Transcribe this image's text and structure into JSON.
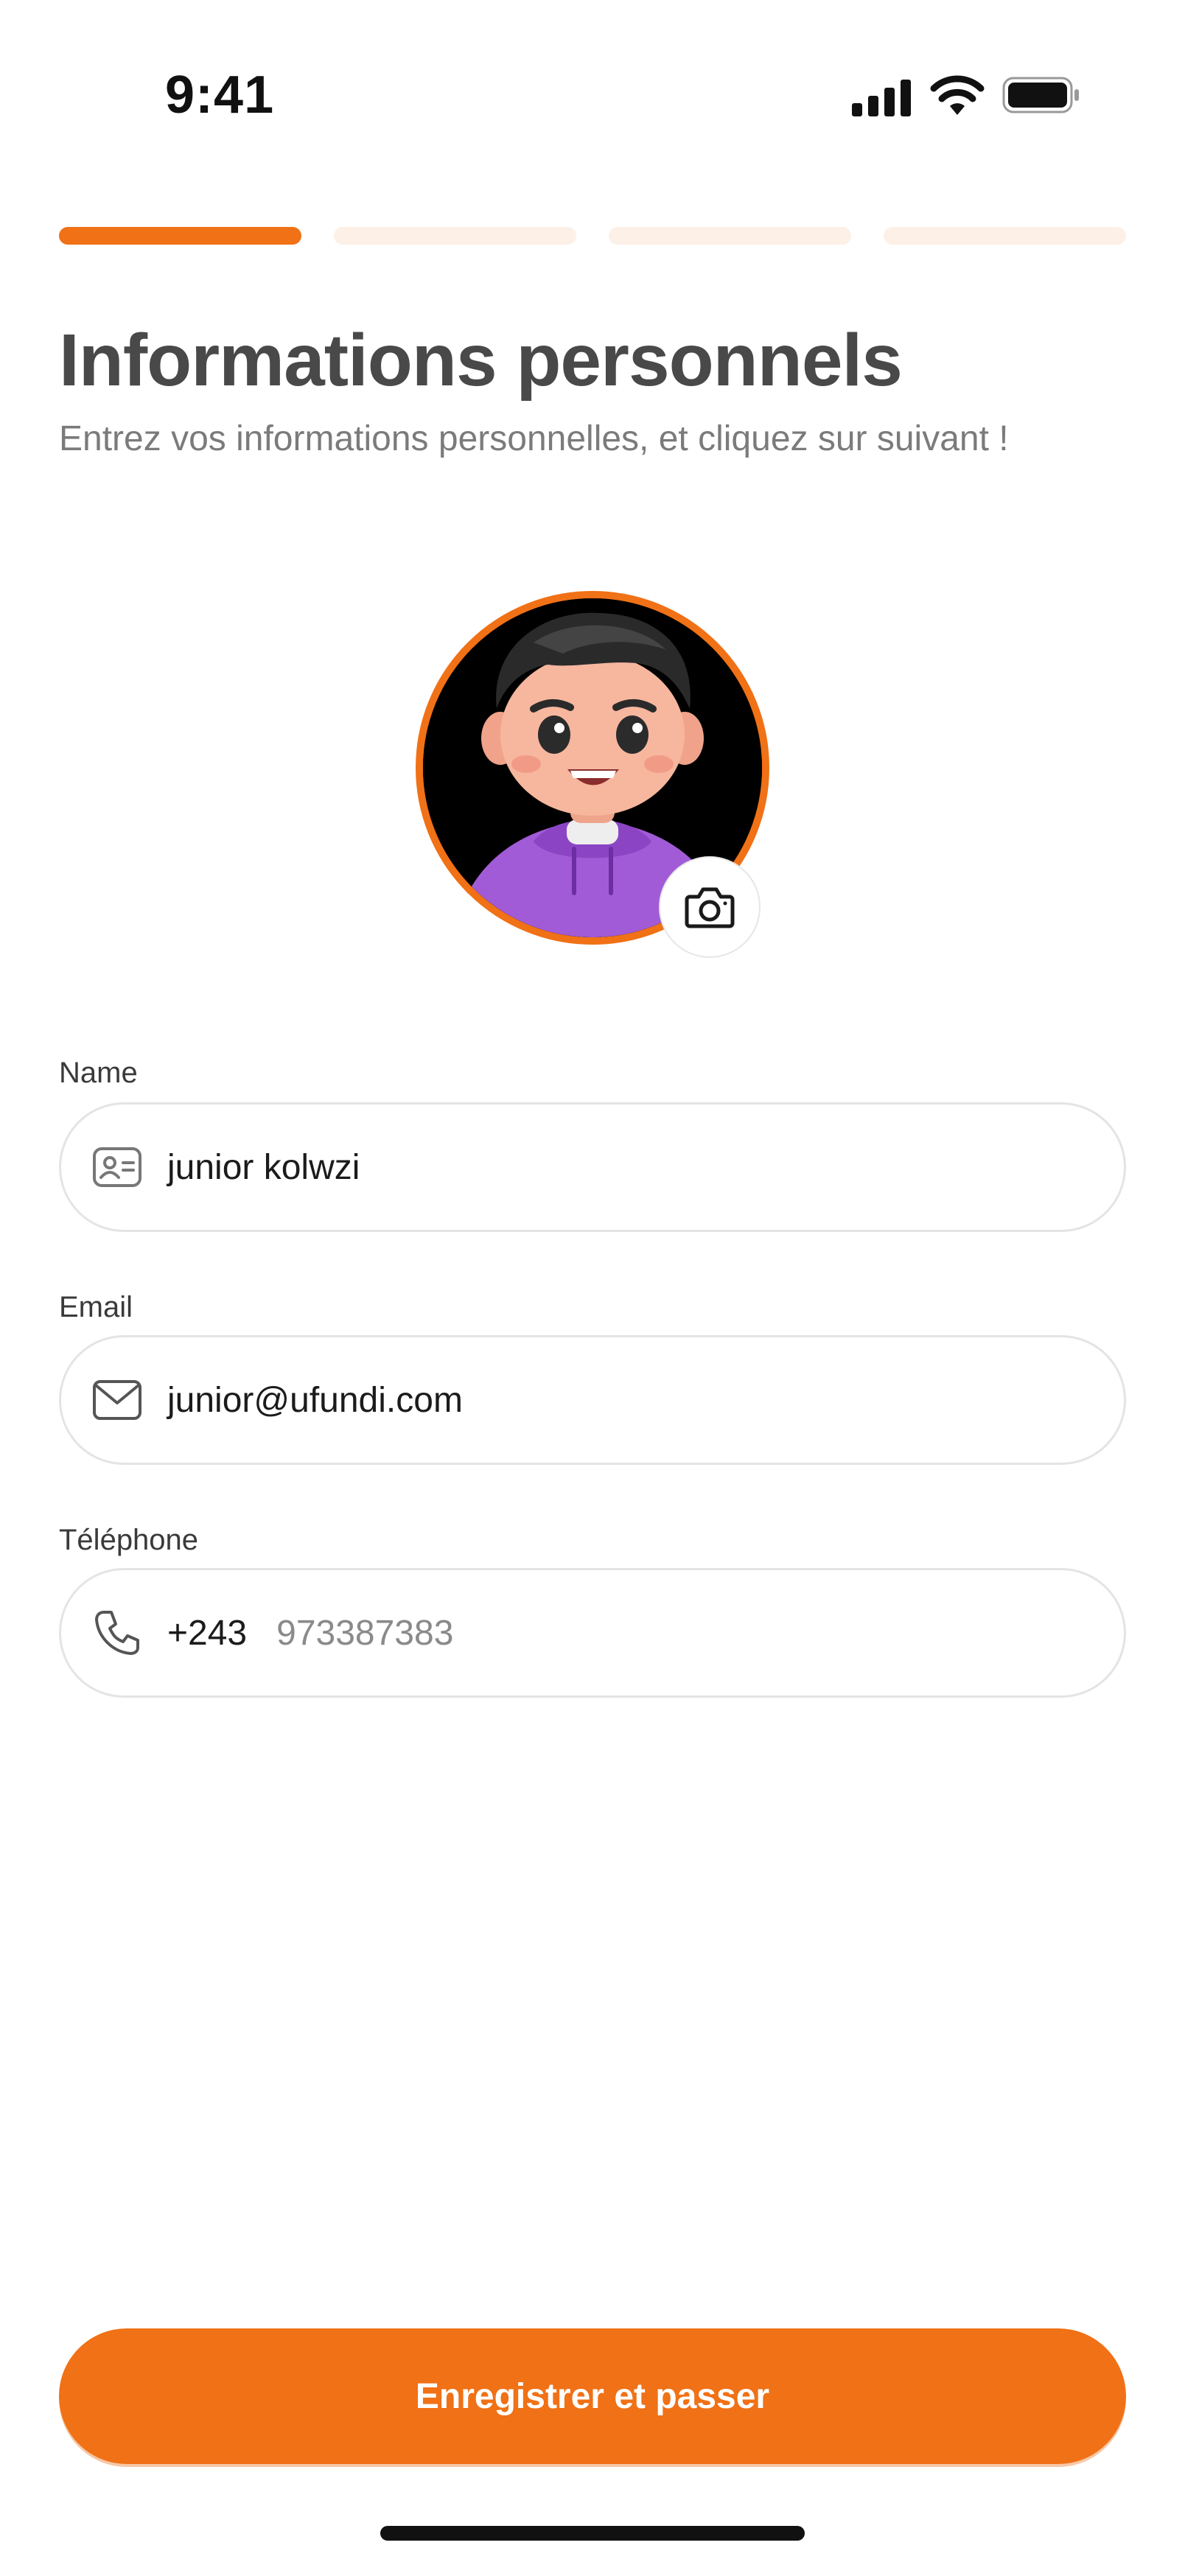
{
  "status_bar": {
    "time": "9:41"
  },
  "progress": {
    "steps": 4,
    "current": 1
  },
  "header": {
    "title": "Informations personnels",
    "subtitle": "Entrez vos informations personnelles, et cliquez sur suivant !"
  },
  "avatar": {
    "description": "user-avatar",
    "camera_icon": "camera-icon"
  },
  "form": {
    "name": {
      "label": "Name",
      "value": "junior kolwzi",
      "icon": "id-card-icon"
    },
    "email": {
      "label": "Email",
      "value": "junior@ufundi.com",
      "icon": "mail-icon"
    },
    "phone": {
      "label": "Téléphone",
      "prefix": "+243",
      "placeholder": "973387383",
      "icon": "phone-icon"
    }
  },
  "submit": {
    "label": "Enregistrer et passer"
  },
  "colors": {
    "accent": "#f07116",
    "accent_light": "#fdf0e6",
    "title": "#494949"
  }
}
